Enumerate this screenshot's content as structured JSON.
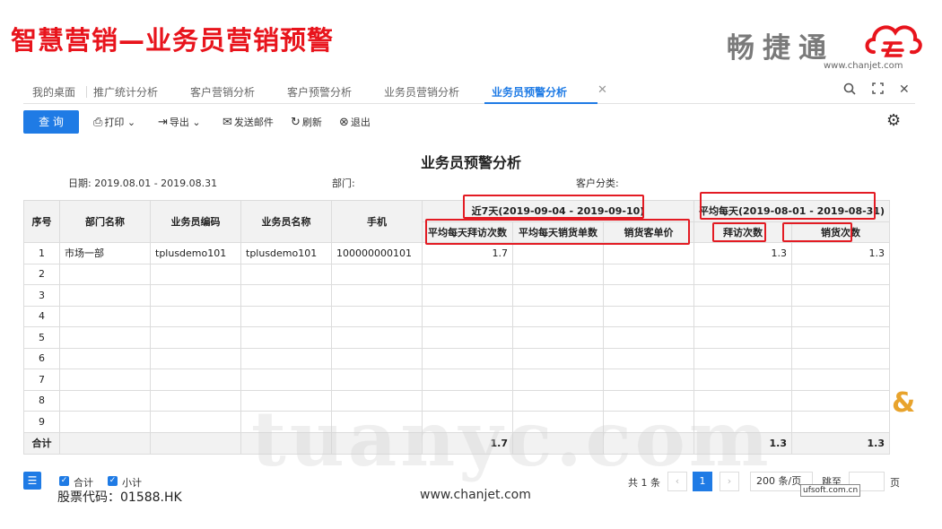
{
  "slide": {
    "title": "智慧营销—业务员营销预警"
  },
  "brand": {
    "name": "畅捷通",
    "url": "www.chanjet.com"
  },
  "tabs": [
    {
      "label": "我的桌面"
    },
    {
      "label": "推广统计分析"
    },
    {
      "label": "客户营销分析"
    },
    {
      "label": "客户预警分析"
    },
    {
      "label": "业务员营销分析"
    },
    {
      "label": "业务员预警分析"
    }
  ],
  "toolbar": {
    "query": "查 询",
    "print": "打印",
    "export": "导出",
    "email": "发送邮件",
    "refresh": "刷新",
    "exit": "退出"
  },
  "report": {
    "title": "业务员预警分析",
    "date_label": "日期:",
    "date_value": "2019.08.01 - 2019.08.31",
    "dept_label": "部门:",
    "customer_class_label": "客户分类:"
  },
  "table": {
    "headers": {
      "idx": "序号",
      "dept": "部门名称",
      "code": "业务员编码",
      "name": "业务员名称",
      "phone": "手机",
      "group7": "近7天(2019-09-04 - 2019-09-10)",
      "groupAvg": "平均每天(2019-08-01 - 2019-08-31)",
      "visits7": "平均每天拜访次数",
      "orders7": "平均每天销货单数",
      "unitprice": "销货客单价",
      "visitsAvg": "拜访次数",
      "salesAvg": "销货次数"
    },
    "rows": [
      {
        "idx": "1",
        "dept": "市场一部",
        "code": "tplusdemo101",
        "name": "tplusdemo101",
        "phone": "100000000101",
        "visits7": "1.7",
        "orders7": "",
        "unitprice": "",
        "visitsAvg": "1.3",
        "salesAvg": "1.3"
      },
      {
        "idx": "2",
        "dept": "",
        "code": "",
        "name": "",
        "phone": "",
        "visits7": "",
        "orders7": "",
        "unitprice": "",
        "visitsAvg": "",
        "salesAvg": ""
      },
      {
        "idx": "3",
        "dept": "",
        "code": "",
        "name": "",
        "phone": "",
        "visits7": "",
        "orders7": "",
        "unitprice": "",
        "visitsAvg": "",
        "salesAvg": ""
      },
      {
        "idx": "4",
        "dept": "",
        "code": "",
        "name": "",
        "phone": "",
        "visits7": "",
        "orders7": "",
        "unitprice": "",
        "visitsAvg": "",
        "salesAvg": ""
      },
      {
        "idx": "5",
        "dept": "",
        "code": "",
        "name": "",
        "phone": "",
        "visits7": "",
        "orders7": "",
        "unitprice": "",
        "visitsAvg": "",
        "salesAvg": ""
      },
      {
        "idx": "6",
        "dept": "",
        "code": "",
        "name": "",
        "phone": "",
        "visits7": "",
        "orders7": "",
        "unitprice": "",
        "visitsAvg": "",
        "salesAvg": ""
      },
      {
        "idx": "7",
        "dept": "",
        "code": "",
        "name": "",
        "phone": "",
        "visits7": "",
        "orders7": "",
        "unitprice": "",
        "visitsAvg": "",
        "salesAvg": ""
      },
      {
        "idx": "8",
        "dept": "",
        "code": "",
        "name": "",
        "phone": "",
        "visits7": "",
        "orders7": "",
        "unitprice": "",
        "visitsAvg": "",
        "salesAvg": ""
      },
      {
        "idx": "9",
        "dept": "",
        "code": "",
        "name": "",
        "phone": "",
        "visits7": "",
        "orders7": "",
        "unitprice": "",
        "visitsAvg": "",
        "salesAvg": ""
      }
    ],
    "footer": {
      "label": "合计",
      "visits7": "1.7",
      "visitsAvg": "1.3",
      "salesAvg": "1.3"
    }
  },
  "footer": {
    "sum_label": "合计",
    "subtotal_label": "小计",
    "total_count": "共 1 条",
    "prev": "‹",
    "page": "1",
    "next": "›",
    "page_size": "200 条/页",
    "jump_label": "跳至",
    "page_label": "页"
  },
  "watermark": "tuanyc.com",
  "tooltip": "ufsoft.com.cn",
  "stock_code": "股票代码：01588.HK",
  "site_url": "www.chanjet.com",
  "colors": {
    "accent": "#1f7be5",
    "title_red": "#e8141c",
    "highlight_box": "#e31b23"
  }
}
